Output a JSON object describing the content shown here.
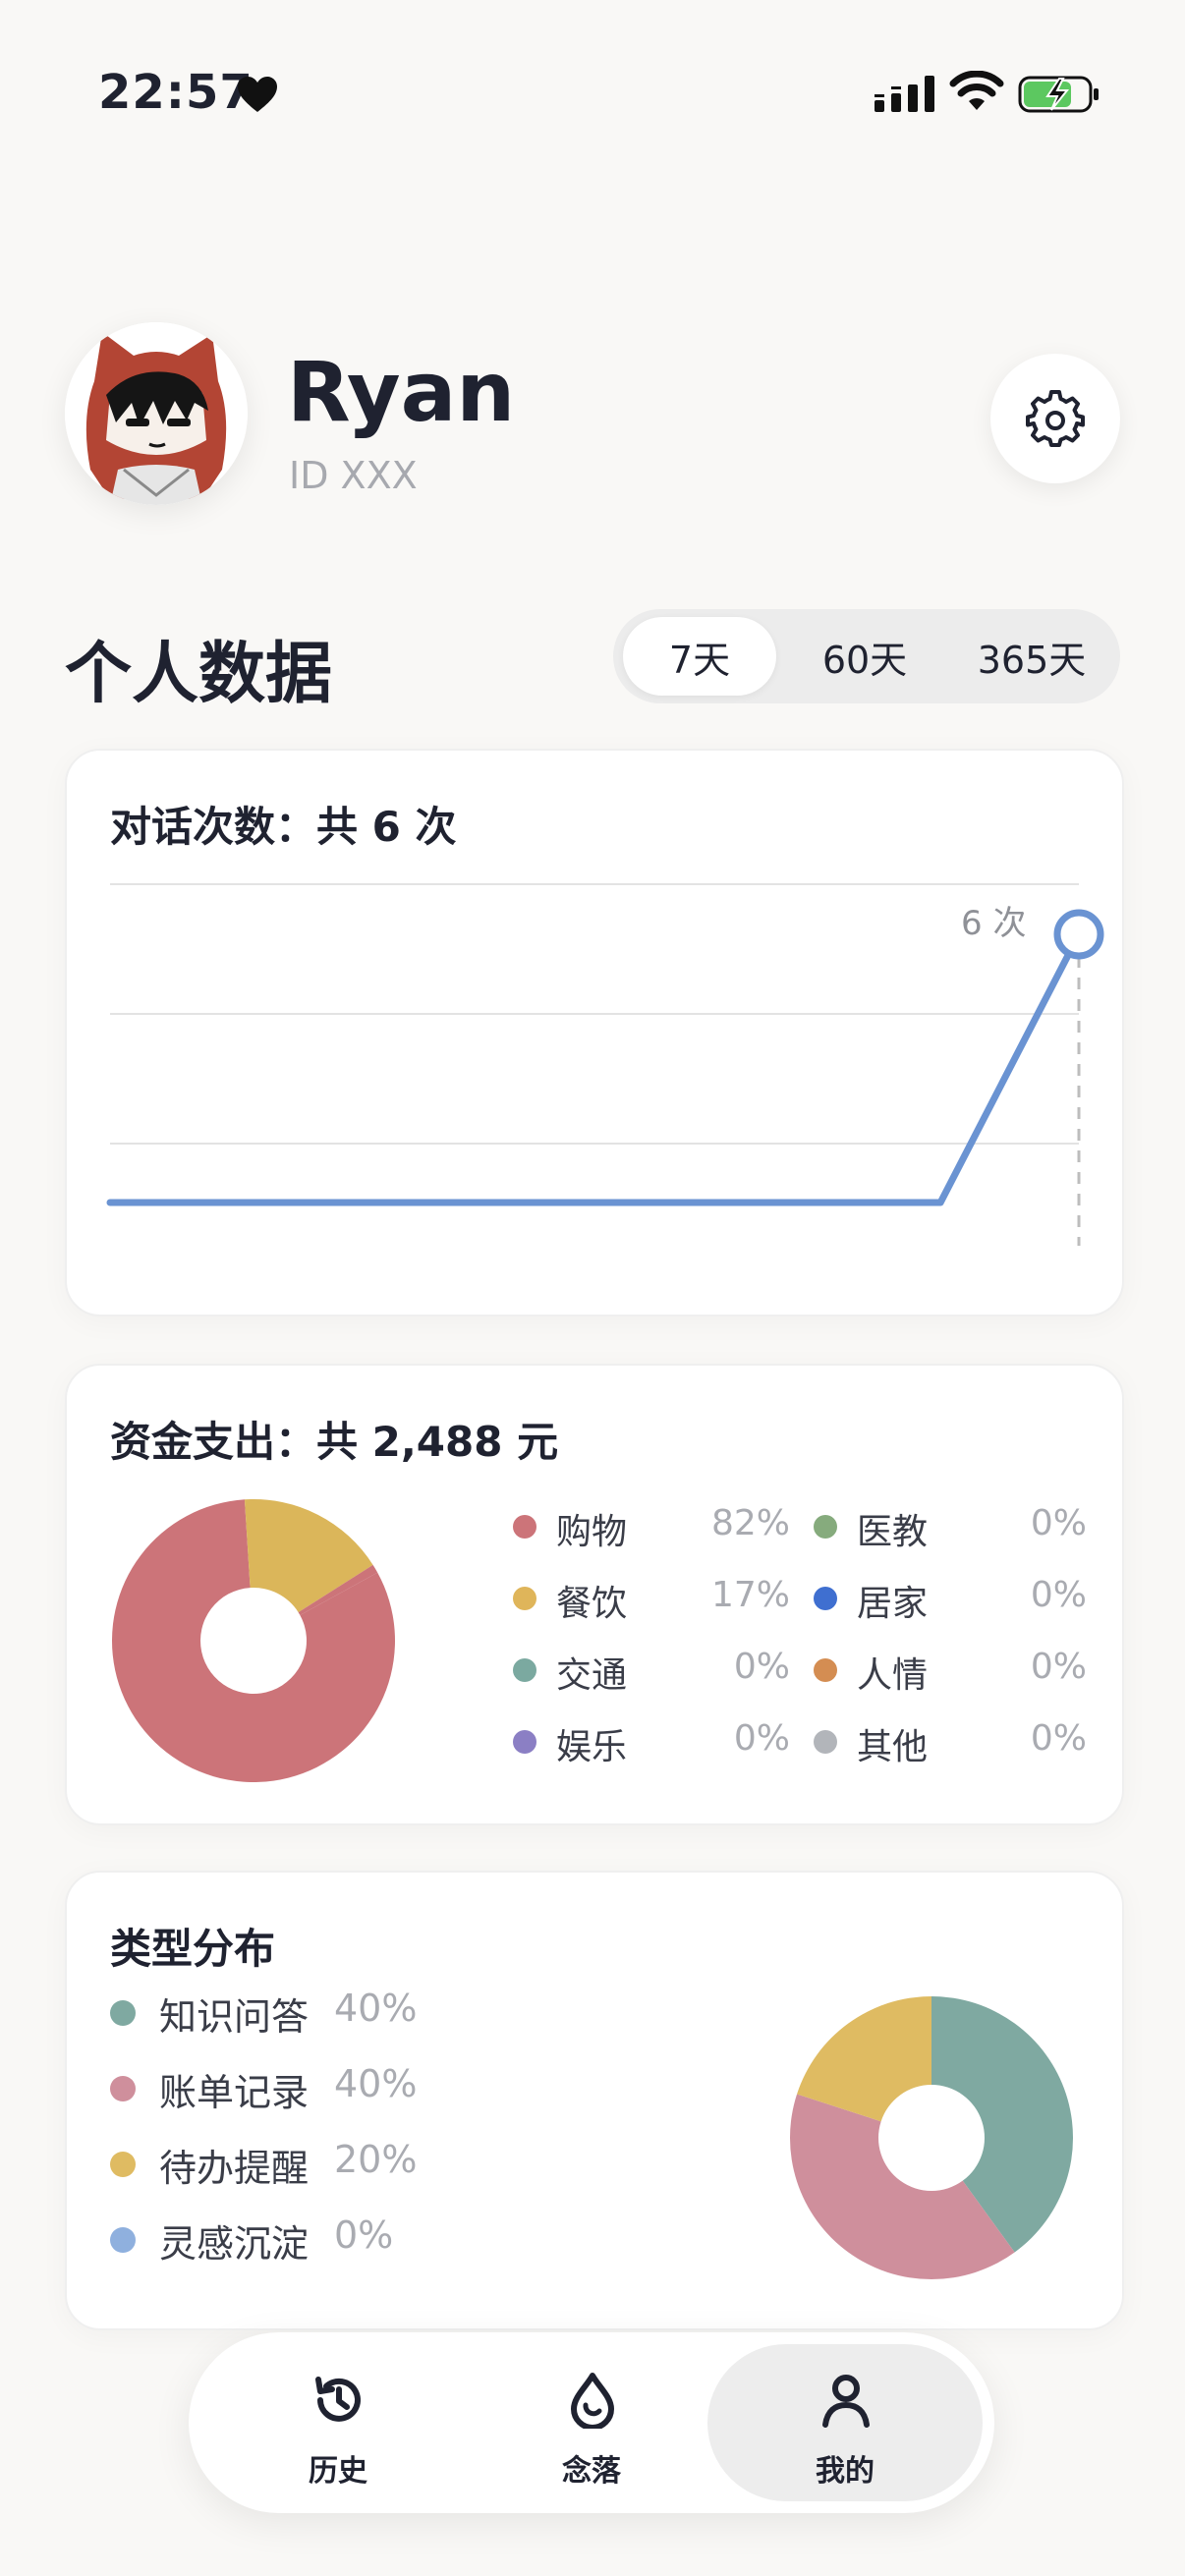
{
  "status_bar": {
    "time": "22:57"
  },
  "profile": {
    "name": "Ryan",
    "id_text": "ID XXX"
  },
  "section": {
    "title": "个人数据",
    "ranges": [
      "7天",
      "60天",
      "365天"
    ],
    "active_range": "7天"
  },
  "conversations": {
    "title": "对话次数：共 6 次",
    "peak_label": "6 次",
    "chart_data": {
      "type": "line",
      "x": [
        1,
        2,
        3,
        4,
        5,
        6,
        7,
        8
      ],
      "values": [
        0,
        0,
        0,
        0,
        0,
        0,
        0,
        6
      ],
      "ylim": [
        0,
        8
      ],
      "color": "#6a93d2"
    }
  },
  "spending": {
    "title": "资金支出：共 2,488 元",
    "legend": [
      {
        "label": "购物",
        "value": "82%",
        "color": "#cc7479"
      },
      {
        "label": "医教",
        "value": "0%",
        "color": "#86ab7d"
      },
      {
        "label": "餐饮",
        "value": "17%",
        "color": "#dfb55a"
      },
      {
        "label": "居家",
        "value": "0%",
        "color": "#3f6fd0"
      },
      {
        "label": "交通",
        "value": "0%",
        "color": "#7ba9a0"
      },
      {
        "label": "人情",
        "value": "0%",
        "color": "#d48d52"
      },
      {
        "label": "娱乐",
        "value": "0%",
        "color": "#8b7fc4"
      },
      {
        "label": "其他",
        "value": "0%",
        "color": "#b2b5ba"
      }
    ],
    "chart_data": {
      "type": "pie",
      "categories": [
        "购物",
        "餐饮"
      ],
      "values": [
        82,
        17
      ],
      "colors": [
        "#cc7479",
        "#dbb65a"
      ]
    }
  },
  "types": {
    "title": "类型分布",
    "legend": [
      {
        "label": "知识问答",
        "value": "40%",
        "color": "#7fa9a1"
      },
      {
        "label": "账单记录",
        "value": "40%",
        "color": "#cf8f9c"
      },
      {
        "label": "待办提醒",
        "value": "20%",
        "color": "#dfbb62"
      },
      {
        "label": "灵感沉淀",
        "value": "0%",
        "color": "#8fb0de"
      }
    ],
    "chart_data": {
      "type": "pie",
      "categories": [
        "知识问答",
        "账单记录",
        "待办提醒"
      ],
      "values": [
        40,
        40,
        20
      ],
      "colors": [
        "#7fa9a1",
        "#cf8f9c",
        "#dfbb62"
      ]
    }
  },
  "nav": {
    "items": [
      {
        "label": "历史",
        "icon": "history-icon"
      },
      {
        "label": "念落",
        "icon": "drop-icon"
      },
      {
        "label": "我的",
        "icon": "person-icon"
      }
    ],
    "active": "我的"
  }
}
